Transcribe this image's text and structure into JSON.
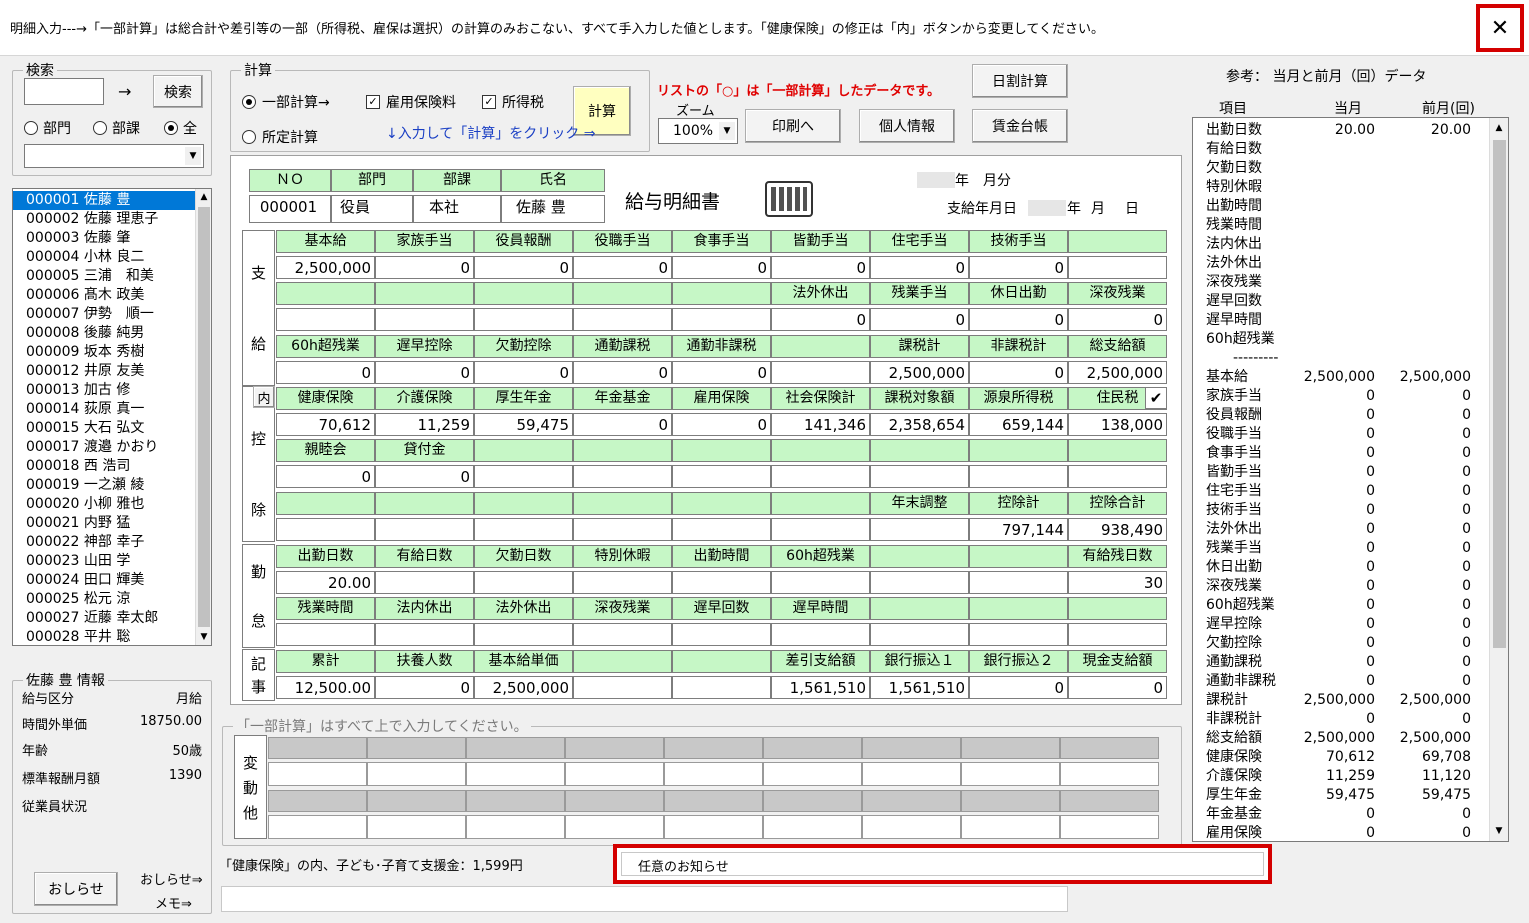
{
  "title_bar": {
    "text": "明細入力---→「一部計算」は総合計や差引等の一部（所得税、雇保は選択）の計算のみおこない、すべて手入力した値とします。「健康保険」の修正は「内」ボタンから変更してください。",
    "close_icon": "close-icon"
  },
  "search": {
    "legend": "検索",
    "arrow": "→",
    "button": "検索",
    "radio_dept": "部門",
    "radio_section": "部課",
    "radio_all": "全"
  },
  "calc": {
    "legend": "計算",
    "radio_partial": "一部計算→",
    "radio_fixed": "所定計算",
    "chk_koyo": "雇用保険料",
    "chk_shotoku": "所得税",
    "button": "計算",
    "hint": "↓入力して「計算」をクリック ⇒"
  },
  "toolbar": {
    "notice": "リストの「○」は「一部計算」したデータです。",
    "zoom_label": "ズーム",
    "zoom_value": "100%",
    "print_button": "印刷へ",
    "personal_button": "個人情報",
    "daily_button": "日割計算",
    "ledger_button": "賃金台帳"
  },
  "employees": [
    "000001 佐藤 豊",
    "000002 佐藤 理恵子",
    "000003 佐藤 肇",
    "000004 小林 良二",
    "000005 三浦　和美",
    "000006 髙木 政美",
    "000007 伊勢　順一",
    "000008 後藤 純男",
    "000009 坂本 秀樹",
    "000012 井原 友美",
    "000013 加古 修",
    "000014 荻原 真一",
    "000015 大石 弘文",
    "000017 渡邉 かおり",
    "000018 西 浩司",
    "000019 一之瀬 綾",
    "000020 小柳 雅也",
    "000021 内野 猛",
    "000022 神部 幸子",
    "000023 山田 学",
    "000024 田口 輝美",
    "000025 松元 涼",
    "000027 近藤 幸太郎",
    "000028 平井 聡"
  ],
  "info": {
    "legend": "佐藤 豊 情報",
    "rows": [
      {
        "label": "給与区分",
        "value": "月給"
      },
      {
        "label": "時間外単価",
        "value": "18750.00"
      },
      {
        "label": "年齢",
        "value": "50歳"
      },
      {
        "label": "標準報酬月額",
        "value": "1390"
      },
      {
        "label": "従業員状況",
        "value": ""
      }
    ],
    "notice_button": "おしらせ",
    "notice_link": "おしらせ⇒",
    "memo_link": "メモ⇒"
  },
  "slip": {
    "no_label": "ＮＯ",
    "dept_label": "部門",
    "section_label": "部課",
    "name_label": "氏名",
    "no": "000001",
    "dept": "役員",
    "section": "本社",
    "name": "佐藤 豊",
    "title": "給与明細書",
    "month_suffix": "年　月分",
    "pay_date_label": "支給年月日",
    "pay_date_y": "年",
    "pay_date_m": "月",
    "pay_date_d": "日",
    "side_shikyu_1": "支",
    "side_shikyu_2": "給",
    "side_kojo_1": "控",
    "side_kojo_2": "除",
    "side_kintai_1": "勤",
    "side_kintai_2": "怠",
    "side_kiji_1": "記",
    "side_kiji_2": "事",
    "uchi_button": "内",
    "check_icon": "✔",
    "rows": [
      {
        "h": [
          "基本給",
          "家族手当",
          "役員報酬",
          "役職手当",
          "食事手当",
          "皆勤手当",
          "住宅手当",
          "技術手当",
          ""
        ],
        "v": [
          "2,500,000",
          "0",
          "0",
          "0",
          "0",
          "0",
          "0",
          "0",
          ""
        ]
      },
      {
        "h": [
          "",
          "",
          "",
          "",
          "",
          "法外休出",
          "残業手当",
          "休日出勤",
          "深夜残業"
        ],
        "v": [
          "",
          "",
          "",
          "",
          "",
          "0",
          "0",
          "0",
          "0"
        ]
      },
      {
        "h": [
          "60h超残業",
          "遅早控除",
          "欠勤控除",
          "通勤課税",
          "通勤非課税",
          "",
          "課税計",
          "非課税計",
          "総支給額"
        ],
        "v": [
          "0",
          "0",
          "0",
          "0",
          "0",
          "",
          "2,500,000",
          "0",
          "2,500,000"
        ]
      },
      {
        "h": [
          "健康保険",
          "介護保険",
          "厚生年金",
          "年金基金",
          "雇用保険",
          "社会保険計",
          "課税対象額",
          "源泉所得税",
          "住民税"
        ],
        "v": [
          "70,612",
          "11,259",
          "59,475",
          "0",
          "0",
          "141,346",
          "2,358,654",
          "659,144",
          "138,000"
        ]
      },
      {
        "h": [
          "親睦会",
          "貸付金",
          "",
          "",
          "",
          "",
          "",
          "",
          ""
        ],
        "v": [
          "0",
          "0",
          "",
          "",
          "",
          "",
          "",
          "",
          ""
        ]
      },
      {
        "h": [
          "",
          "",
          "",
          "",
          "",
          "",
          "年末調整",
          "控除計",
          "控除合計"
        ],
        "v": [
          "",
          "",
          "",
          "",
          "",
          "",
          "",
          "797,144",
          "938,490"
        ]
      },
      {
        "h": [
          "出勤日数",
          "有給日数",
          "欠勤日数",
          "特別休暇",
          "出勤時間",
          "60h超残業",
          "",
          "",
          "有給残日数"
        ],
        "v": [
          "20.00",
          "",
          "",
          "",
          "",
          "",
          "",
          "",
          "30"
        ]
      },
      {
        "h": [
          "残業時間",
          "法内休出",
          "法外休出",
          "深夜残業",
          "遅早回数",
          "遅早時間",
          "",
          "",
          ""
        ],
        "v": [
          "",
          "",
          "",
          "",
          "",
          "",
          "",
          "",
          ""
        ]
      },
      {
        "h": [
          "累計",
          "扶養人数",
          "基本給単価",
          "",
          "",
          "差引支給額",
          "銀行振込１",
          "銀行振込２",
          "現金支給額"
        ],
        "v": [
          "12,500.00",
          "0",
          "2,500,000",
          "",
          "",
          "1,561,510",
          "1,561,510",
          "0",
          "0"
        ]
      }
    ]
  },
  "henko": {
    "legend": "「一部計算」はすべて上で入力してください。",
    "side_1": "変",
    "side_2": "動",
    "side_3": "他"
  },
  "bottom": {
    "kodomo": "「健康保険」の内、子ども･子育て支援金：1,599円",
    "notice_field": "任意のお知らせ"
  },
  "reference": {
    "title": "参考：  当月と前月（回）データ",
    "col_item": "項目",
    "col_current": "当月",
    "col_prev": "前月(回)",
    "separator": "---------",
    "rows1": [
      {
        "k": "出勤日数",
        "c": "20.00",
        "p": "20.00"
      },
      {
        "k": "有給日数",
        "c": "",
        "p": ""
      },
      {
        "k": "欠勤日数",
        "c": "",
        "p": ""
      },
      {
        "k": "特別休暇",
        "c": "",
        "p": ""
      },
      {
        "k": "出勤時間",
        "c": "",
        "p": ""
      },
      {
        "k": "残業時間",
        "c": "",
        "p": ""
      },
      {
        "k": "法内休出",
        "c": "",
        "p": ""
      },
      {
        "k": "法外休出",
        "c": "",
        "p": ""
      },
      {
        "k": "深夜残業",
        "c": "",
        "p": ""
      },
      {
        "k": "遅早回数",
        "c": "",
        "p": ""
      },
      {
        "k": "遅早時間",
        "c": "",
        "p": ""
      },
      {
        "k": "60h超残業",
        "c": "",
        "p": ""
      }
    ],
    "rows2": [
      {
        "k": "基本給",
        "c": "2,500,000",
        "p": "2,500,000"
      },
      {
        "k": "家族手当",
        "c": "0",
        "p": "0"
      },
      {
        "k": "役員報酬",
        "c": "0",
        "p": "0"
      },
      {
        "k": "役職手当",
        "c": "0",
        "p": "0"
      },
      {
        "k": "食事手当",
        "c": "0",
        "p": "0"
      },
      {
        "k": "皆勤手当",
        "c": "0",
        "p": "0"
      },
      {
        "k": "住宅手当",
        "c": "0",
        "p": "0"
      },
      {
        "k": "技術手当",
        "c": "0",
        "p": "0"
      },
      {
        "k": "法外休出",
        "c": "0",
        "p": "0"
      },
      {
        "k": "残業手当",
        "c": "0",
        "p": "0"
      },
      {
        "k": "休日出勤",
        "c": "0",
        "p": "0"
      },
      {
        "k": "深夜残業",
        "c": "0",
        "p": "0"
      },
      {
        "k": "60h超残業",
        "c": "0",
        "p": "0"
      },
      {
        "k": "遅早控除",
        "c": "0",
        "p": "0"
      },
      {
        "k": "欠勤控除",
        "c": "0",
        "p": "0"
      },
      {
        "k": "通勤課税",
        "c": "0",
        "p": "0"
      },
      {
        "k": "通勤非課税",
        "c": "0",
        "p": "0"
      },
      {
        "k": "課税計",
        "c": "2,500,000",
        "p": "2,500,000"
      },
      {
        "k": "非課税計",
        "c": "0",
        "p": "0"
      },
      {
        "k": "総支給額",
        "c": "2,500,000",
        "p": "2,500,000"
      },
      {
        "k": "健康保険",
        "c": "70,612",
        "p": "69,708"
      },
      {
        "k": "介護保険",
        "c": "11,259",
        "p": "11,120"
      },
      {
        "k": "厚生年金",
        "c": "59,475",
        "p": "59,475"
      },
      {
        "k": "年金基金",
        "c": "0",
        "p": "0"
      },
      {
        "k": "雇用保険",
        "c": "0",
        "p": "0"
      }
    ]
  }
}
